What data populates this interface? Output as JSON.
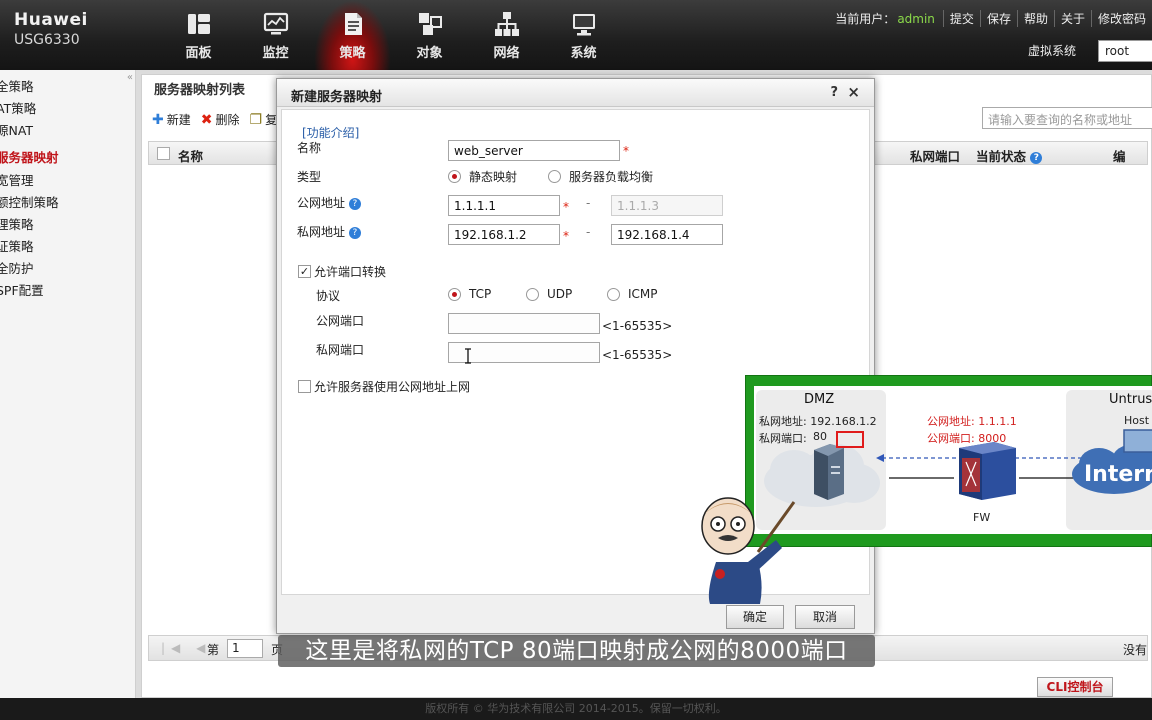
{
  "header": {
    "brand_name": "Huawei",
    "brand_model": "USG6330",
    "nav": [
      {
        "label": "面板",
        "icon": "dashboard-icon"
      },
      {
        "label": "监控",
        "icon": "monitor-icon"
      },
      {
        "label": "策略",
        "icon": "policy-icon",
        "active": true
      },
      {
        "label": "对象",
        "icon": "object-icon"
      },
      {
        "label": "网络",
        "icon": "network-icon"
      },
      {
        "label": "系统",
        "icon": "system-icon"
      }
    ],
    "current_user_label": "当前用户：",
    "current_user": "admin",
    "links": [
      "提交",
      "保存",
      "帮助",
      "关于",
      "修改密码"
    ],
    "vsys_label": "虚拟系统",
    "vsys_value": "root"
  },
  "sidebar": {
    "items": [
      {
        "label": "全策略"
      },
      {
        "label": "AT策略"
      },
      {
        "label": "源NAT"
      },
      {
        "label": "服务器映射",
        "active": true
      },
      {
        "label": "宽管理"
      },
      {
        "label": "额控制策略"
      },
      {
        "label": "理策略"
      },
      {
        "label": "证策略"
      },
      {
        "label": "全防护"
      },
      {
        "label": "SPF配置"
      }
    ]
  },
  "list_panel": {
    "title": "服务器映射列表",
    "toolbar": {
      "new": "新建",
      "delete": "删除",
      "copy": "复"
    },
    "search_placeholder": "请输入要查询的名称或地址",
    "columns": {
      "name": "名称",
      "private_port": "私网端口",
      "state": "当前状态",
      "edit": "编"
    },
    "pager": {
      "page_label": "第",
      "page_value": "1",
      "of_label": "页",
      "no_data": "没有"
    }
  },
  "dialog": {
    "title": "新建服务器映射",
    "help": "?",
    "close": "×",
    "func_intro": "[功能介绍]",
    "name_label": "名称",
    "name_value": "web_server",
    "type_label": "类型",
    "type_options": [
      {
        "label": "静态映射",
        "checked": true
      },
      {
        "label": "服务器负载均衡",
        "checked": false
      }
    ],
    "public_addr_label": "公网地址",
    "public_addr_start": "1.1.1.1",
    "public_addr_end": "1.1.1.3",
    "private_addr_label": "私网地址",
    "private_addr_start": "192.168.1.2",
    "private_addr_end": "192.168.1.4",
    "allow_port_trans": "允许端口转换",
    "protocol_label": "协议",
    "protocols": [
      {
        "label": "TCP",
        "checked": true
      },
      {
        "label": "UDP",
        "checked": false
      },
      {
        "label": "ICMP",
        "checked": false
      }
    ],
    "public_port_label": "公网端口",
    "public_port_value": "",
    "private_port_label": "私网端口",
    "private_port_value": "",
    "port_range_hint": "<1-65535>",
    "allow_public_access": "允许服务器使用公网地址上网",
    "ok": "确定",
    "cancel": "取消"
  },
  "diagram": {
    "dmz_title": "DMZ",
    "dmz_private_addr": "私网地址: 192.168.1.2",
    "dmz_private_port_label": "私网端口:",
    "dmz_private_port_value": "80",
    "public_addr": "公网地址: 1.1.1.1",
    "public_port": "公网端口: 8000",
    "fw_label": "FW",
    "untrust_title": "Untrust",
    "host_label": "Host",
    "internet_label": "Intern"
  },
  "subtitle": "这里是将私网的TCP 80端口映射成公网的8000端口",
  "cli_button": "CLI控制台",
  "footer": "版权所有 © 华为技术有限公司 2014-2015。保留一切权利。"
}
